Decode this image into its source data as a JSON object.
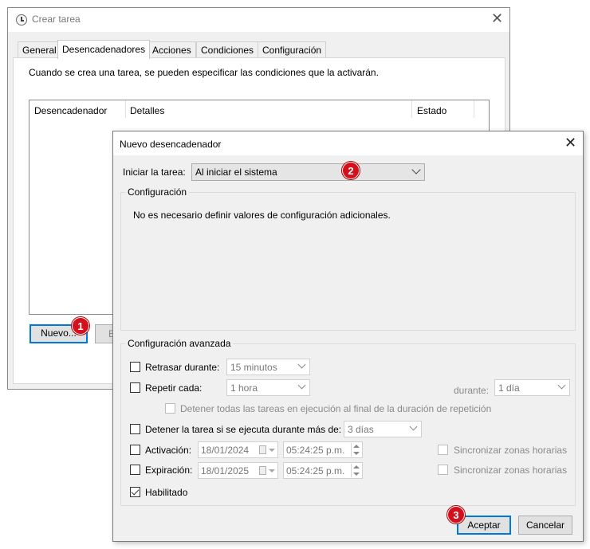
{
  "background_window": {
    "title": "Crear tarea",
    "tabs": [
      "General",
      "Desencadenadores",
      "Acciones",
      "Condiciones",
      "Configuración"
    ],
    "active_tab": "Desencadenadores",
    "description": "Cuando se crea una tarea, se pueden especificar las condiciones que la activarán.",
    "columns": [
      "Desencadenador",
      "Detalles",
      "Estado"
    ],
    "new_button": "Nuevo...",
    "edit_button_partial": "E"
  },
  "dialog": {
    "title": "Nuevo desencadenador",
    "begin_label": "Iniciar la tarea:",
    "begin_value": "Al iniciar el sistema",
    "config_group": "Configuración",
    "config_text": "No es necesario definir valores de configuración adicionales.",
    "advanced_group": "Configuración avanzada",
    "delay": {
      "label": "Retrasar durante:",
      "checked": false,
      "value": "15 minutos"
    },
    "repeat": {
      "label": "Repetir cada:",
      "checked": false,
      "value": "1 hora",
      "duration_label": "durante:",
      "duration_value": "1 día"
    },
    "stop_all": {
      "label": "Detener todas las tareas en ejecución al final de la duración de repetición",
      "checked": false,
      "disabled": true
    },
    "stop_if": {
      "label": "Detener la tarea si se ejecuta durante más de:",
      "checked": false,
      "value": "3 días"
    },
    "activation": {
      "label": "Activación:",
      "checked": false,
      "date": "18/01/2024",
      "time": "05:24:25 p.m.",
      "sync_label": "Sincronizar zonas horarias"
    },
    "expiration": {
      "label": "Expiración:",
      "checked": false,
      "date": "18/01/2025",
      "time": "05:24:25 p.m.",
      "sync_label": "Sincronizar zonas horarias"
    },
    "enabled": {
      "label": "Habilitado",
      "checked": true
    },
    "ok_button": "Aceptar",
    "cancel_button": "Cancelar"
  },
  "callouts": {
    "one": "1",
    "two": "2",
    "three": "3"
  },
  "colors": {
    "accent": "#0078d7",
    "badge": "#d4101d",
    "window_bg": "#f0f0f0"
  },
  "icons": [
    "clock-icon",
    "close-icon",
    "chevron-down-icon",
    "calendar-icon",
    "spin-icon",
    "check-icon"
  ]
}
